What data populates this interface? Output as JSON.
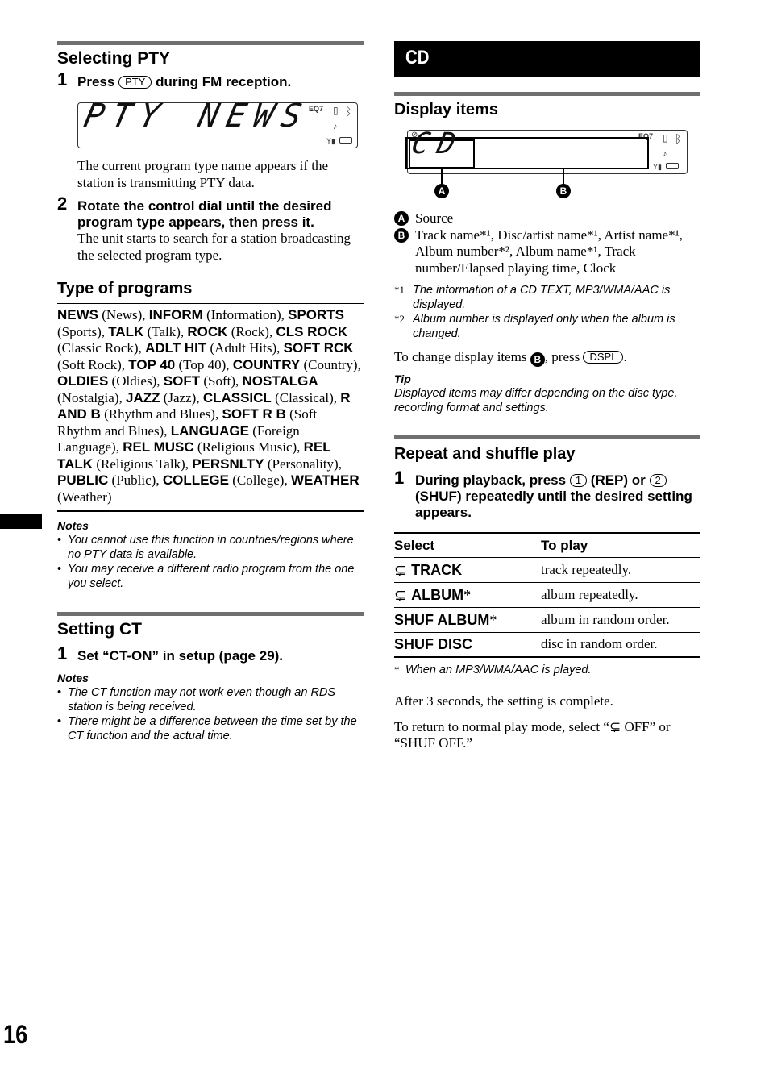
{
  "page_number": "16",
  "left": {
    "selecting_pty": {
      "title": "Selecting PTY",
      "step1": {
        "num": "1",
        "prefix": "Press",
        "key": "PTY",
        "suffix": "during FM reception."
      },
      "lcd": {
        "text_left": "PTY",
        "text_right": "NEWS",
        "icons": [
          "eq-icon",
          "phone-icon",
          "bluetooth-icon",
          "music-icon",
          "signal-icon",
          "battery-icon"
        ],
        "eq_label": "EQ7"
      },
      "step1_desc": "The current program type name appears if the station is transmitting PTY data.",
      "step2": {
        "num": "2",
        "text": "Rotate the control dial until the desired program type appears, then press it."
      },
      "step2_desc": "The unit starts to search for a station broadcasting the selected program type."
    },
    "type_of_programs": {
      "title": "Type of programs",
      "items": [
        {
          "code": "NEWS",
          "desc": "(News)"
        },
        {
          "code": "INFORM",
          "desc": "(Information)"
        },
        {
          "code": "SPORTS",
          "desc": "(Sports)"
        },
        {
          "code": "TALK",
          "desc": "(Talk)"
        },
        {
          "code": "ROCK",
          "desc": "(Rock)"
        },
        {
          "code": "CLS ROCK",
          "desc": "(Classic Rock)"
        },
        {
          "code": "ADLT HIT",
          "desc": "(Adult Hits)"
        },
        {
          "code": "SOFT RCK",
          "desc": "(Soft Rock)"
        },
        {
          "code": "TOP 40",
          "desc": "(Top 40)"
        },
        {
          "code": "COUNTRY",
          "desc": "(Country)"
        },
        {
          "code": "OLDIES",
          "desc": "(Oldies)"
        },
        {
          "code": "SOFT",
          "desc": "(Soft)"
        },
        {
          "code": "NOSTALGA",
          "desc": "(Nostalgia)"
        },
        {
          "code": "JAZZ",
          "desc": "(Jazz)"
        },
        {
          "code": "CLASSICL",
          "desc": "(Classical)"
        },
        {
          "code": "R AND B",
          "desc": "(Rhythm and Blues)"
        },
        {
          "code": "SOFT R B",
          "desc": "(Soft Rhythm and Blues)"
        },
        {
          "code": "LANGUAGE",
          "desc": "(Foreign Language)"
        },
        {
          "code": "REL MUSC",
          "desc": "(Religious Music)"
        },
        {
          "code": "REL TALK",
          "desc": "(Religious Talk)"
        },
        {
          "code": "PERSNLTY",
          "desc": "(Personality)"
        },
        {
          "code": "PUBLIC",
          "desc": "(Public)"
        },
        {
          "code": "COLLEGE",
          "desc": "(College)"
        },
        {
          "code": "WEATHER",
          "desc": "(Weather)"
        }
      ]
    },
    "notes1": {
      "title": "Notes",
      "items": [
        "You cannot use this function in countries/regions where no PTY data is available.",
        "You may receive a different radio program from the one you select."
      ]
    },
    "setting_ct": {
      "title": "Setting CT",
      "step1": {
        "num": "1",
        "text": "Set “CT-ON” in setup (page 29)."
      },
      "notes_title": "Notes",
      "notes": [
        "The CT function may not work even though an RDS station is being received.",
        "There might be a difference between the time set by the CT function and the actual time."
      ]
    }
  },
  "right": {
    "banner": "CD",
    "display_items": {
      "title": "Display items",
      "lcd": {
        "source_text": "CD",
        "callout_a": "A",
        "callout_b": "B",
        "eq_label": "EQ7"
      },
      "legend": [
        {
          "letter": "A",
          "text": "Source"
        },
        {
          "letter": "B",
          "text": "Track name*¹, Disc/artist name*¹, Artist name*¹, Album number*², Album name*¹, Track number/Elapsed playing time, Clock"
        }
      ],
      "footnotes": [
        {
          "mark": "*1",
          "text": "The information of a CD TEXT, MP3/WMA/AAC is displayed."
        },
        {
          "mark": "*2",
          "text": "Album number is displayed only when the album is changed."
        }
      ],
      "change_text_prefix": "To change display items",
      "change_letter": "B",
      "change_text_mid": ", press",
      "change_key": "DSPL",
      "change_text_suffix": ".",
      "tip_title": "Tip",
      "tip_text": "Displayed items may differ depending on the disc type, recording format and settings."
    },
    "repeat_shuffle": {
      "title": "Repeat and shuffle play",
      "step1": {
        "num": "1",
        "part1": "During playback, press",
        "key1": "1",
        "part2": "(REP) or",
        "key2": "2",
        "part3": "(SHUF) repeatedly until the desired setting appears."
      },
      "table": {
        "headers": [
          "Select",
          "To play"
        ],
        "rows": [
          {
            "icon": true,
            "select": "TRACK",
            "star": "",
            "play": "track repeatedly."
          },
          {
            "icon": true,
            "select": "ALBUM",
            "star": "*",
            "play": "album repeatedly."
          },
          {
            "icon": false,
            "select": "SHUF ALBUM",
            "star": "*",
            "play": "album in random order."
          },
          {
            "icon": false,
            "select": "SHUF DISC",
            "star": "",
            "play": "disc in random order."
          }
        ]
      },
      "table_footnote": {
        "mark": "*",
        "text": "When an MP3/WMA/AAC is played."
      },
      "after_text": "After 3 seconds, the setting is complete.",
      "return_prefix": "To return to normal play mode, select “",
      "return_mid": " OFF” or “SHUF OFF.”"
    }
  }
}
